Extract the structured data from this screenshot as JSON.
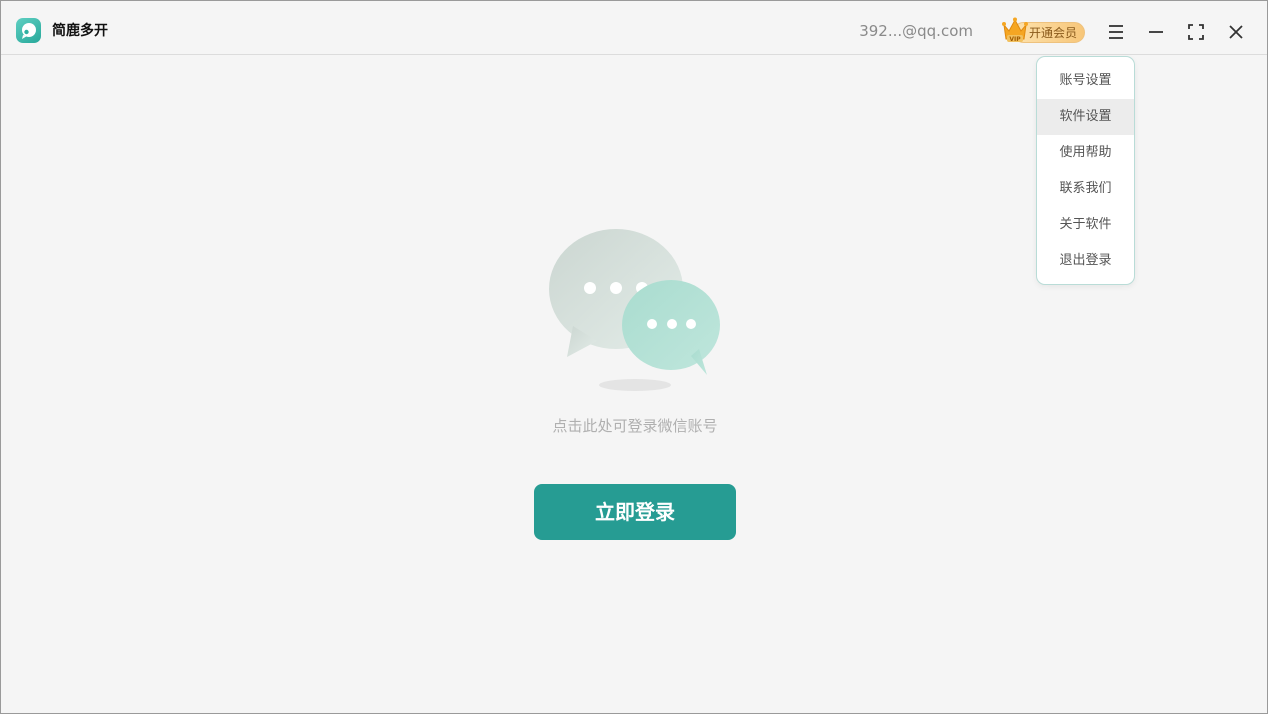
{
  "window": {
    "app_title": "简鹿多开",
    "app_logo_icon": "speech-bubble-logo-icon"
  },
  "header": {
    "account_email": "392...@qq.com",
    "vip_button_label": "开通会员",
    "vip_badge_text": "VIP",
    "icons": [
      "crown-icon",
      "menu-icon",
      "minimize-icon",
      "maximize-icon",
      "close-icon"
    ]
  },
  "dropdown_menu": {
    "items": [
      {
        "label": "账号设置"
      },
      {
        "label": "软件设置"
      },
      {
        "label": "使用帮助"
      },
      {
        "label": "联系我们"
      },
      {
        "label": "关于软件"
      },
      {
        "label": "退出登录"
      }
    ],
    "highlighted_index": 1
  },
  "main": {
    "illustration_icon": "chat-bubbles-icon",
    "hint_text": "点击此处可登录微信账号",
    "login_button_label": "立即登录"
  },
  "colors": {
    "accent": "#269c93",
    "background": "#f5f5f5",
    "vip_gold": "#f7c679"
  }
}
